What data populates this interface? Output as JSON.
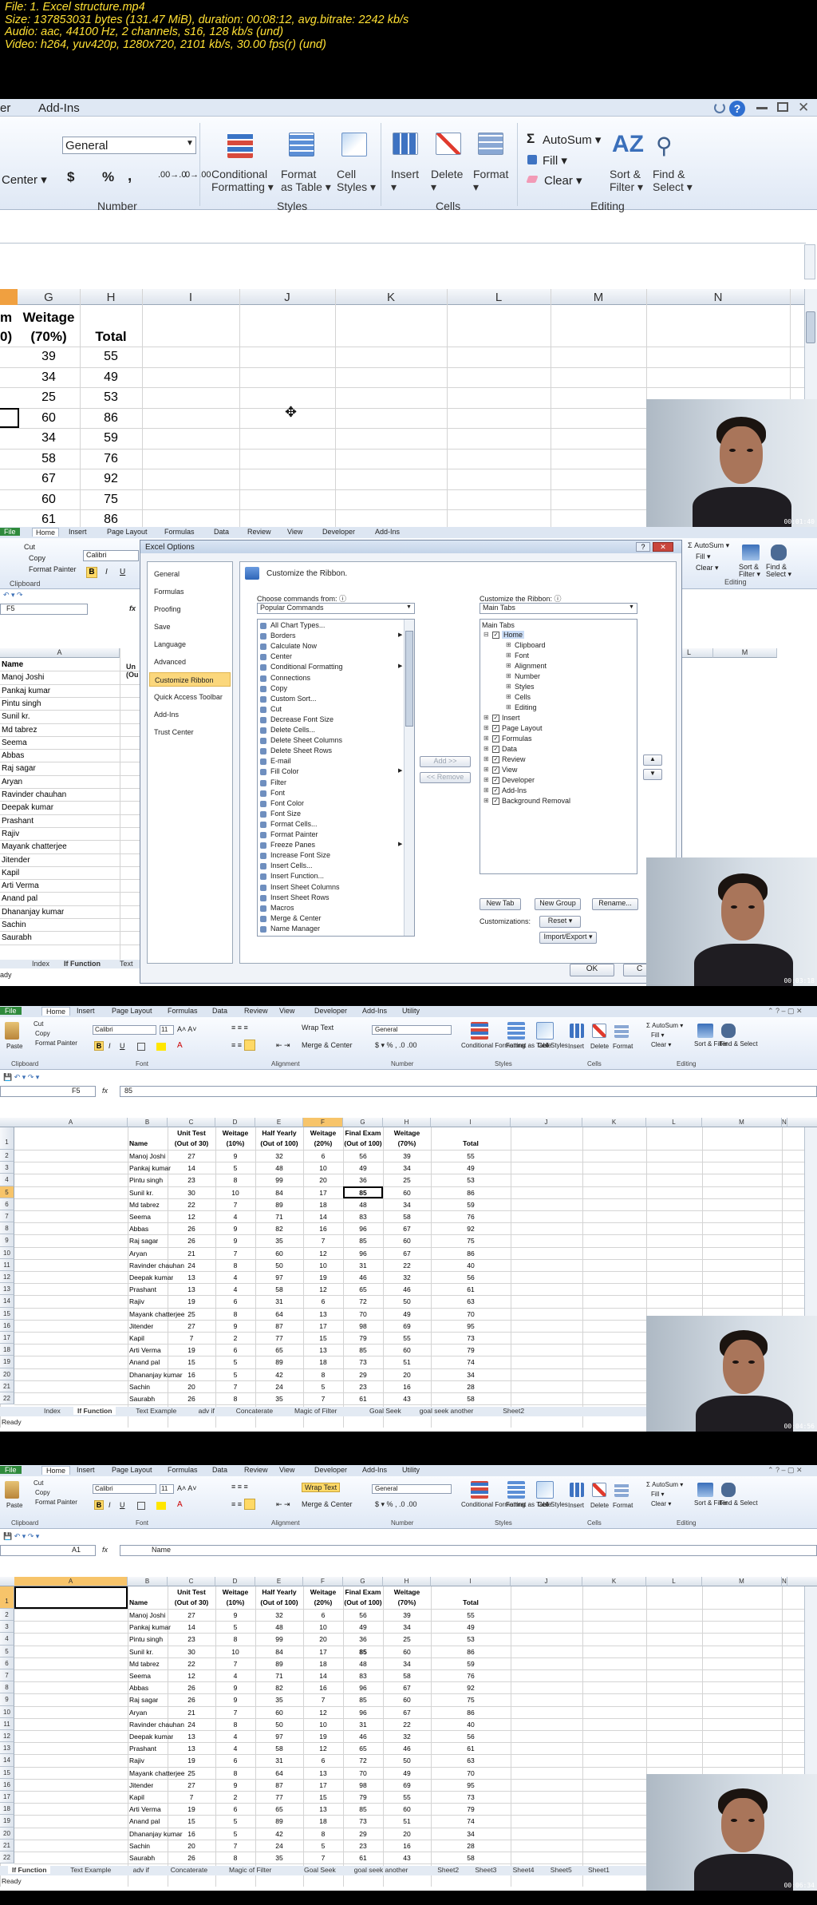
{
  "meta": {
    "line1": "File: 1. Excel structure.mp4",
    "line2": "Size: 137853031 bytes (131.47 MiB), duration: 00:08:12, avg.bitrate: 2242 kb/s",
    "line3": "Audio: aac, 44100 Hz, 2 channels, s16, 128 kb/s (und)",
    "line4": "Video: h264, yuv420p, 1280x720, 2101 kb/s, 30.00 fps(r) (und)"
  },
  "timestamps": [
    "00:01:40",
    "00:03:18",
    "00:04:56",
    "00:06:34"
  ],
  "frame1": {
    "tabs": [
      "er",
      "Add-Ins"
    ],
    "number_format": "General",
    "alignment_label": "Center",
    "number_symbols": [
      "$",
      "%",
      ","
    ],
    "group_labels": [
      "Number",
      "Styles",
      "Cells",
      "Editing"
    ],
    "buttons": [
      "Conditional",
      "Formatting",
      "Format",
      "as Table",
      "Cell",
      "Styles",
      "Insert",
      "Delete",
      "Format",
      "AutoSum",
      "Fill",
      "Clear",
      "Sort &",
      "Filter",
      "Find &",
      "Select"
    ],
    "col_headers": [
      "G",
      "H",
      "I",
      "J",
      "K",
      "L",
      "M",
      "N"
    ],
    "partial_header": [
      "m",
      "0)"
    ],
    "head_g": [
      "Weitage",
      "(70%)"
    ],
    "head_h": "Total",
    "rows": [
      [
        "39",
        "55"
      ],
      [
        "34",
        "49"
      ],
      [
        "25",
        "53"
      ],
      [
        "60",
        "86"
      ],
      [
        "34",
        "59"
      ],
      [
        "58",
        "76"
      ],
      [
        "67",
        "92"
      ],
      [
        "60",
        "75"
      ],
      [
        "61",
        "86"
      ]
    ]
  },
  "frame2": {
    "tabs": [
      "File",
      "Home",
      "Insert",
      "Page Layout",
      "Formulas",
      "Data",
      "Review",
      "View",
      "Developer",
      "Add-Ins"
    ],
    "clipboard": [
      "Cut",
      "Copy",
      "Format Painter",
      "Clipboard"
    ],
    "font": "Calibri",
    "name_box": "F5",
    "col_a": "A",
    "col_u": [
      "Un",
      "(Ou"
    ],
    "right_cols": [
      "L",
      "M"
    ],
    "names": [
      "Name",
      "Manoj Joshi",
      "Pankaj kumar",
      "Pintu singh",
      "Sunil kr.",
      "Md tabrez",
      "Seema",
      "Abbas",
      "Raj sagar",
      "Aryan",
      "Ravinder chauhan",
      "Deepak kumar",
      "Prashant",
      "Rajiv",
      "Mayank chatterjee",
      "Jitender",
      "Kapil",
      "Arti Verma",
      "Anand pal",
      "Dhananjay kumar",
      "Sachin",
      "Saurabh"
    ],
    "sheet_tabs": [
      "Index",
      "If Function",
      "Text"
    ],
    "status": "ady",
    "right_ribbon": [
      "AutoSum",
      "Fill",
      "Clear",
      "Sort &",
      "Filter",
      "Find &",
      "Select",
      "Editing"
    ],
    "dialog": {
      "title": "Excel Options",
      "nav": [
        "General",
        "Formulas",
        "Proofing",
        "Save",
        "Language",
        "Advanced",
        "Customize Ribbon",
        "Quick Access Toolbar",
        "Add-Ins",
        "Trust Center"
      ],
      "heading": "Customize the Ribbon.",
      "choose_label": "Choose commands from:",
      "choose_value": "Popular Commands",
      "customize_label": "Customize the Ribbon:",
      "customize_value": "Main Tabs",
      "commands": [
        "All Chart Types...",
        "Borders",
        "Calculate Now",
        "Center",
        "Conditional Formatting",
        "Connections",
        "Copy",
        "Custom Sort...",
        "Cut",
        "Decrease Font Size",
        "Delete Cells...",
        "Delete Sheet Columns",
        "Delete Sheet Rows",
        "E-mail",
        "Fill Color",
        "Filter",
        "Font",
        "Font Color",
        "Font Size",
        "Format Cells...",
        "Format Painter",
        "Freeze Panes",
        "Increase Font Size",
        "Insert Cells...",
        "Insert Function...",
        "Insert Sheet Columns",
        "Insert Sheet Rows",
        "Macros",
        "Merge & Center",
        "Name Manager"
      ],
      "tree_header": "Main Tabs",
      "tree": [
        "Home",
        "Clipboard",
        "Font",
        "Alignment",
        "Number",
        "Styles",
        "Cells",
        "Editing",
        "Insert",
        "Page Layout",
        "Formulas",
        "Data",
        "Review",
        "View",
        "Developer",
        "Add-Ins",
        "Background Removal"
      ],
      "add": "Add >>",
      "remove": "<< Remove",
      "new_tab": "New Tab",
      "new_group": "New Group",
      "rename": "Rename...",
      "customizations": "Customizations:",
      "reset": "Reset",
      "import_export": "Import/Export",
      "ok": "OK",
      "cancel": "C"
    }
  },
  "frame3": {
    "tabs": [
      "File",
      "Home",
      "Insert",
      "Page Layout",
      "Formulas",
      "Data",
      "Review",
      "View",
      "Developer",
      "Add-Ins",
      "Utility"
    ],
    "name_box": "F5",
    "formula": "85",
    "font": "Calibri",
    "size": "11",
    "groups": [
      "Clipboard",
      "Font",
      "Alignment",
      "Number",
      "Styles",
      "Cells",
      "Editing"
    ],
    "wrap": "Wrap Text",
    "merge": "Merge & Center",
    "general": "General",
    "ribbon_btns": [
      "Conditional",
      "Formatting",
      "Format",
      "as Table",
      "Cell",
      "Styles",
      "Insert",
      "Delete",
      "Format",
      "AutoSum",
      "Fill",
      "Clear",
      "Sort &",
      "Filter",
      "Find &",
      "Select",
      "Paste",
      "Cut",
      "Copy",
      "Format Painter"
    ],
    "cols": [
      "A",
      "B",
      "C",
      "D",
      "E",
      "F",
      "G",
      "H",
      "I",
      "J",
      "K",
      "L",
      "M",
      "N"
    ],
    "header1": [
      "",
      "Unit Test",
      "Weitage",
      "Half Yearly",
      "Weitage",
      "Final Exam",
      "Weitage",
      ""
    ],
    "header2": [
      "Name",
      "(Out of 30)",
      "(10%)",
      "(Out of 100)",
      "(20%)",
      "(Out of 100)",
      "(70%)",
      "Total"
    ],
    "rows": [
      [
        "Manoj Joshi",
        "27",
        "9",
        "32",
        "6",
        "56",
        "39",
        "55"
      ],
      [
        "Pankaj kumar",
        "14",
        "5",
        "48",
        "10",
        "49",
        "34",
        "49"
      ],
      [
        "Pintu singh",
        "23",
        "8",
        "99",
        "20",
        "36",
        "25",
        "53"
      ],
      [
        "Sunil kr.",
        "30",
        "10",
        "84",
        "17",
        "85",
        "60",
        "86"
      ],
      [
        "Md tabrez",
        "22",
        "7",
        "89",
        "18",
        "48",
        "34",
        "59"
      ],
      [
        "Seema",
        "12",
        "4",
        "71",
        "14",
        "83",
        "58",
        "76"
      ],
      [
        "Abbas",
        "26",
        "9",
        "82",
        "16",
        "96",
        "67",
        "92"
      ],
      [
        "Raj sagar",
        "26",
        "9",
        "35",
        "7",
        "85",
        "60",
        "75"
      ],
      [
        "Aryan",
        "21",
        "7",
        "60",
        "12",
        "96",
        "67",
        "86"
      ],
      [
        "Ravinder chauhan",
        "24",
        "8",
        "50",
        "10",
        "31",
        "22",
        "40"
      ],
      [
        "Deepak kumar",
        "13",
        "4",
        "97",
        "19",
        "46",
        "32",
        "56"
      ],
      [
        "Prashant",
        "13",
        "4",
        "58",
        "12",
        "65",
        "46",
        "61"
      ],
      [
        "Rajiv",
        "19",
        "6",
        "31",
        "6",
        "72",
        "50",
        "63"
      ],
      [
        "Mayank chatterjee",
        "25",
        "8",
        "64",
        "13",
        "70",
        "49",
        "70"
      ],
      [
        "Jitender",
        "27",
        "9",
        "87",
        "17",
        "98",
        "69",
        "95"
      ],
      [
        "Kapil",
        "7",
        "2",
        "77",
        "15",
        "79",
        "55",
        "73"
      ],
      [
        "Arti Verma",
        "19",
        "6",
        "65",
        "13",
        "85",
        "60",
        "79"
      ],
      [
        "Anand pal",
        "15",
        "5",
        "89",
        "18",
        "73",
        "51",
        "74"
      ],
      [
        "Dhananjay kumar",
        "16",
        "5",
        "42",
        "8",
        "29",
        "20",
        "34"
      ],
      [
        "Sachin",
        "20",
        "7",
        "24",
        "5",
        "23",
        "16",
        "28"
      ],
      [
        "Saurabh",
        "26",
        "8",
        "35",
        "7",
        "61",
        "43",
        "58"
      ]
    ],
    "sheet_tabs": [
      "Index",
      "If Function",
      "Text Example",
      "adv if",
      "Concaterate",
      "Magic of Filter",
      "Goal Seek",
      "goal seek another",
      "Sheet2"
    ],
    "status": "Ready"
  },
  "frame4": {
    "name_box": "A1",
    "formula": "Name",
    "sheet_tabs": [
      "If Function",
      "Text Example",
      "adv if",
      "Concaterate",
      "Magic of Filter",
      "Goal Seek",
      "goal seek another",
      "Sheet2",
      "Sheet3",
      "Sheet4",
      "Sheet5",
      "Sheet1"
    ],
    "status": "Ready"
  }
}
